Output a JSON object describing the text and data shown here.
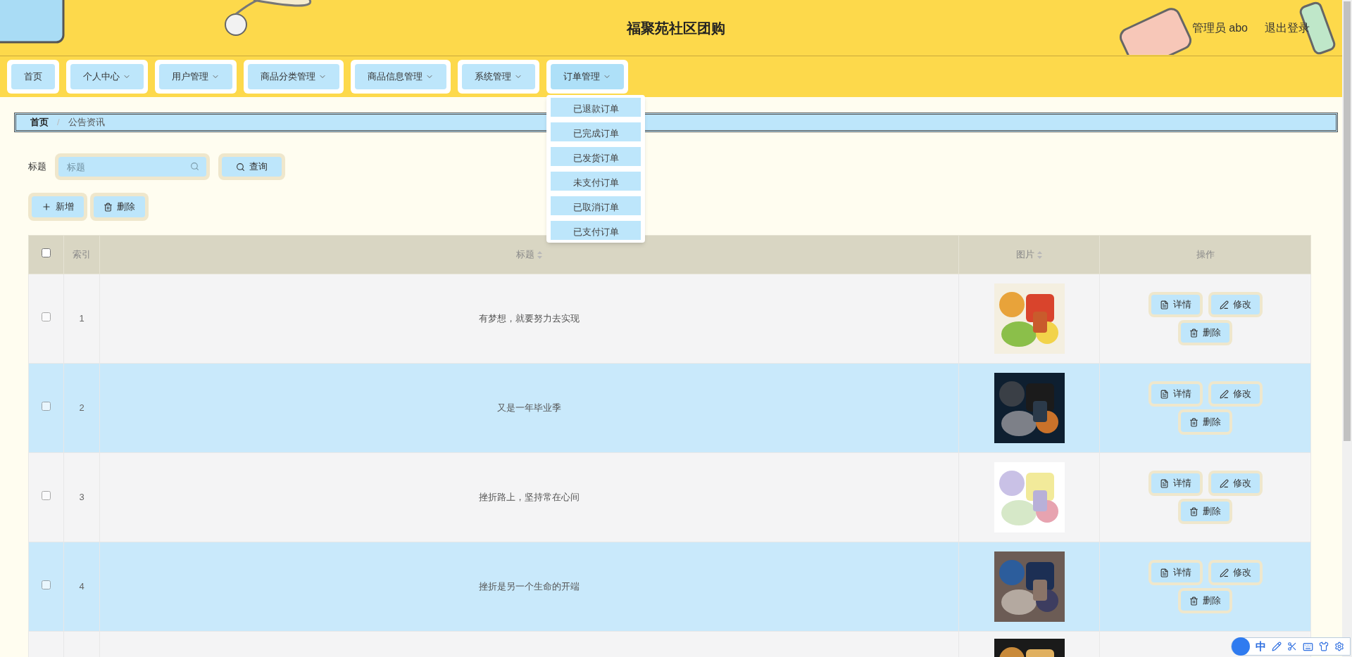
{
  "header": {
    "title": "福聚苑社区团购",
    "user": "管理员 abo",
    "logout": "退出登录"
  },
  "nav": [
    {
      "label": "首页",
      "has_menu": false,
      "open": false
    },
    {
      "label": "个人中心",
      "has_menu": true,
      "open": false
    },
    {
      "label": "用户管理",
      "has_menu": true,
      "open": false
    },
    {
      "label": "商品分类管理",
      "has_menu": true,
      "open": false
    },
    {
      "label": "商品信息管理",
      "has_menu": true,
      "open": false
    },
    {
      "label": "系统管理",
      "has_menu": true,
      "open": false
    },
    {
      "label": "订单管理",
      "has_menu": true,
      "open": true,
      "menu": [
        "已退款订单",
        "已完成订单",
        "已发货订单",
        "未支付订单",
        "已取消订单",
        "已支付订单"
      ]
    }
  ],
  "breadcrumb": {
    "items": [
      "首页",
      "公告资讯"
    ],
    "separator": "/"
  },
  "search": {
    "label": "标题",
    "placeholder": "标题",
    "button": "查询"
  },
  "actions": [
    "新增",
    "删除"
  ],
  "table": {
    "select_all": {
      "checked": false
    },
    "columns": [
      "索引",
      "标题",
      "图片",
      "操作"
    ],
    "rows": [
      {
        "index": "1",
        "title": "有梦想，就要努力去实现",
        "checked": false,
        "image": {
          "kind": "picture"
        },
        "buttons": [
          "详情",
          "修改",
          "删除"
        ]
      },
      {
        "index": "2",
        "title": "又是一年毕业季",
        "checked": false,
        "image": {
          "kind": "picture"
        },
        "buttons": [
          "详情",
          "修改",
          "删除"
        ]
      },
      {
        "index": "3",
        "title": "挫折路上，坚持常在心间",
        "checked": false,
        "image": {
          "kind": "picture"
        },
        "buttons": [
          "详情",
          "修改",
          "删除"
        ]
      },
      {
        "index": "4",
        "title": "挫折是另一个生命的开端",
        "checked": false,
        "image": {
          "kind": "picture"
        },
        "buttons": [
          "详情",
          "修改",
          "删除"
        ]
      },
      {
        "image": {
          "kind": "picture"
        }
      }
    ]
  },
  "ime_toolbar": {
    "mode": "中"
  }
}
